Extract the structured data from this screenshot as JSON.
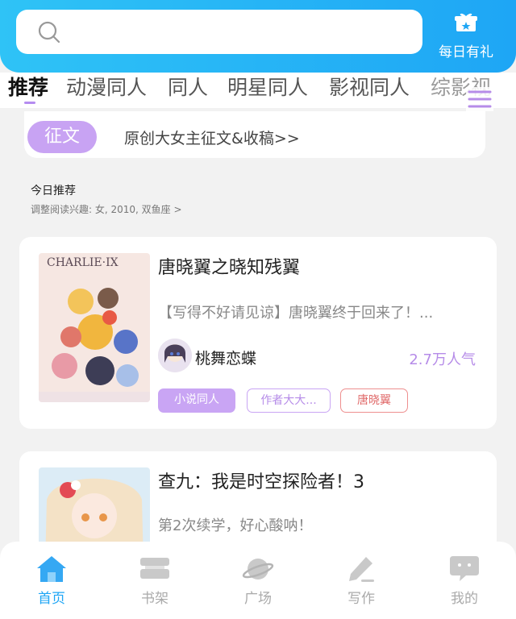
{
  "header": {
    "daily_gift_label": "每日有礼"
  },
  "tabs": [
    {
      "label": "推荐",
      "active": true
    },
    {
      "label": "动漫同人"
    },
    {
      "label": "同人"
    },
    {
      "label": "明星同人"
    },
    {
      "label": "影视同人"
    },
    {
      "label": "综影视"
    }
  ],
  "contest": {
    "badge": "征文",
    "text": "原创大女主征文&收稿>>"
  },
  "section": {
    "title": "今日推荐",
    "subtitle": "调整阅读兴趣: 女, 2010, 双鱼座 >"
  },
  "books": [
    {
      "cover_text": "CHARLIE·IX",
      "title": "唐晓翼之晓知残翼",
      "desc": "【写得不好请见谅】唐晓翼终于回来了！...",
      "author": "桃舞恋蝶",
      "popularity": "2.7万人气",
      "tags": [
        "小说同人",
        "作者大大...",
        "唐晓翼"
      ]
    },
    {
      "title": "查九：我是时空探险者！3",
      "desc": "第2次续学，好心酸呐！"
    }
  ],
  "bottom_nav": [
    {
      "label": "首页",
      "icon": "home-icon",
      "active": true
    },
    {
      "label": "书架",
      "icon": "bookshelf-icon"
    },
    {
      "label": "广场",
      "icon": "planet-icon"
    },
    {
      "label": "写作",
      "icon": "pen-icon"
    },
    {
      "label": "我的",
      "icon": "chat-bubble-icon"
    }
  ],
  "colors": {
    "brand_blue": "#1ea6f5",
    "accent_purple": "#c8a3f3",
    "tag_red": "#e06a6a"
  }
}
